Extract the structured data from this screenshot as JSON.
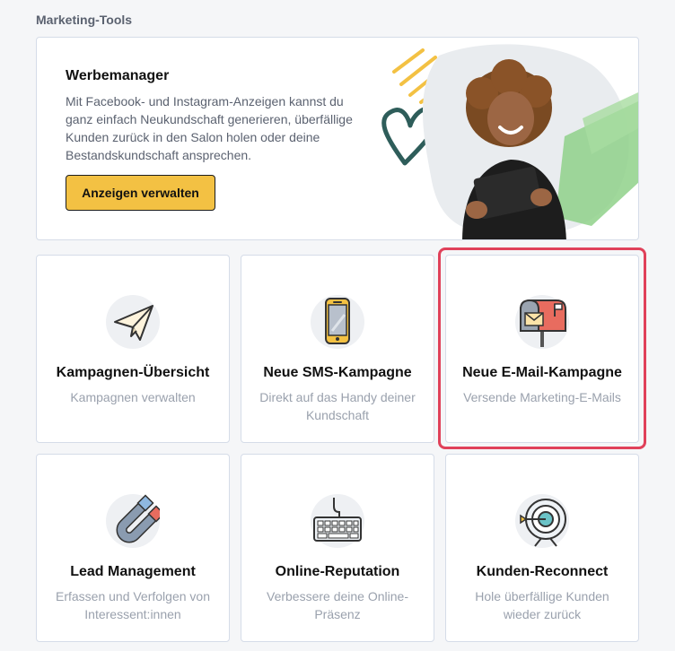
{
  "section": {
    "title": "Marketing-Tools"
  },
  "promo": {
    "title": "Werbemanager",
    "text": "Mit Facebook- und Instagram-Anzeigen kannst du ganz einfach Neukundschaft generieren, überfällige Kunden zurück in den Salon holen oder deine Bestandskundschaft ansprechen.",
    "button_label": "Anzeigen verwalten",
    "image": "woman-with-tablet-illustration"
  },
  "cards": [
    {
      "title": "Kampagnen-Übersicht",
      "subtitle": "Kampagnen verwalten",
      "icon": "paper-plane-icon"
    },
    {
      "title": "Neue SMS-Kampagne",
      "subtitle": "Direkt auf das Handy deiner Kundschaft",
      "icon": "smartphone-icon"
    },
    {
      "title": "Neue E-Mail-Kampagne",
      "subtitle": "Versende Marketing-E-Mails",
      "icon": "mailbox-icon",
      "highlighted": true
    },
    {
      "title": "Lead Management",
      "subtitle": "Erfassen und Verfolgen von Interessent:innen",
      "icon": "magnet-icon"
    },
    {
      "title": "Online-Reputation",
      "subtitle": "Verbessere deine Online-Präsenz",
      "icon": "keyboard-icon"
    },
    {
      "title": "Kunden-Reconnect",
      "subtitle": "Hole überfällige Kunden wieder zurück",
      "icon": "target-icon"
    }
  ],
  "colors": {
    "accent_button": "#f3c143",
    "highlight_border": "#e0415a",
    "muted_text": "#9aa1ad"
  }
}
